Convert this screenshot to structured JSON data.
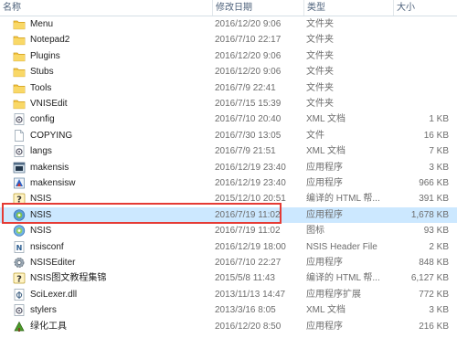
{
  "columns": {
    "name": "名称",
    "date": "修改日期",
    "type": "类型",
    "size": "大小"
  },
  "files": [
    {
      "name": "Menu",
      "date": "2016/12/20 9:06",
      "type": "文件夹",
      "size": "",
      "icon": "folder-icon"
    },
    {
      "name": "Notepad2",
      "date": "2016/7/10 22:17",
      "type": "文件夹",
      "size": "",
      "icon": "folder-icon"
    },
    {
      "name": "Plugins",
      "date": "2016/12/20 9:06",
      "type": "文件夹",
      "size": "",
      "icon": "folder-icon"
    },
    {
      "name": "Stubs",
      "date": "2016/12/20 9:06",
      "type": "文件夹",
      "size": "",
      "icon": "folder-icon"
    },
    {
      "name": "Tools",
      "date": "2016/7/9 22:41",
      "type": "文件夹",
      "size": "",
      "icon": "folder-icon"
    },
    {
      "name": "VNISEdit",
      "date": "2016/7/15 15:39",
      "type": "文件夹",
      "size": "",
      "icon": "folder-icon"
    },
    {
      "name": "config",
      "date": "2016/7/10 20:40",
      "type": "XML 文档",
      "size": "1 KB",
      "icon": "xml-gear-icon"
    },
    {
      "name": "COPYING",
      "date": "2016/7/30 13:05",
      "type": "文件",
      "size": "16 KB",
      "icon": "blank-file-icon"
    },
    {
      "name": "langs",
      "date": "2016/7/9 21:51",
      "type": "XML 文档",
      "size": "7 KB",
      "icon": "xml-gear-icon"
    },
    {
      "name": "makensis",
      "date": "2016/12/19 23:40",
      "type": "应用程序",
      "size": "3 KB",
      "icon": "console-app-icon"
    },
    {
      "name": "makensisw",
      "date": "2016/12/19 23:40",
      "type": "应用程序",
      "size": "966 KB",
      "icon": "makensisw-app-icon"
    },
    {
      "name": "NSIS",
      "date": "2015/12/10 20:51",
      "type": "编译的 HTML 帮...",
      "size": "391 KB",
      "icon": "chm-help-icon"
    },
    {
      "name": "NSIS",
      "date": "2016/7/19 11:02",
      "type": "应用程序",
      "size": "1,678 KB",
      "icon": "nsis-app-icon",
      "selected": true
    },
    {
      "name": "NSIS",
      "date": "2016/7/19 11:02",
      "type": "图标",
      "size": "93 KB",
      "icon": "nsis-icon-file-icon"
    },
    {
      "name": "nsisconf",
      "date": "2016/12/19 18:00",
      "type": "NSIS Header File",
      "size": "2 KB",
      "icon": "nsh-file-icon"
    },
    {
      "name": "NSISEditer",
      "date": "2016/7/10 22:27",
      "type": "应用程序",
      "size": "848 KB",
      "icon": "gear-app-icon"
    },
    {
      "name": "NSIS图文教程集锦",
      "date": "2015/5/8 11:43",
      "type": "编译的 HTML 帮...",
      "size": "6,127 KB",
      "icon": "chm-help-icon"
    },
    {
      "name": "SciLexer.dll",
      "date": "2013/11/13 14:47",
      "type": "应用程序扩展",
      "size": "772 KB",
      "icon": "dll-file-icon"
    },
    {
      "name": "stylers",
      "date": "2013/3/16 8:05",
      "type": "XML 文档",
      "size": "3 KB",
      "icon": "xml-gear-icon"
    },
    {
      "name": "绿化工具",
      "date": "2016/12/20 8:50",
      "type": "应用程序",
      "size": "216 KB",
      "icon": "green-tool-app-icon"
    }
  ],
  "colors": {
    "selected_row": "#cce8ff",
    "highlight_box": "#e53b35",
    "folder": "#f4c542"
  }
}
